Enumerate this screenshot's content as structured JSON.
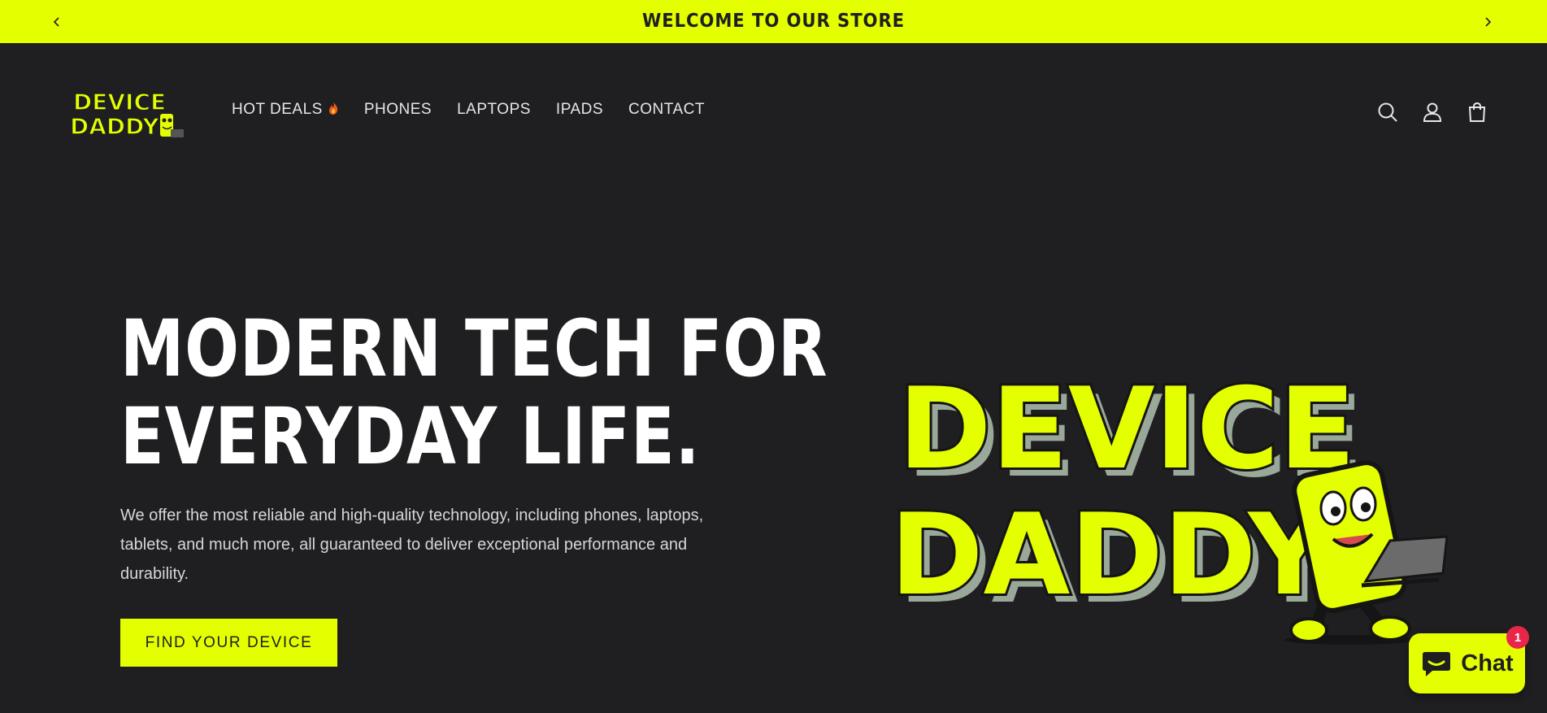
{
  "announcement": {
    "text": "WELCOME TO OUR STORE",
    "prev_icon": "chevron-left-icon",
    "next_icon": "chevron-right-icon"
  },
  "header": {
    "logo_text": [
      "DEVICE",
      "DADDY"
    ],
    "nav": [
      {
        "label": "HOT DEALS",
        "icon": "fire-icon"
      },
      {
        "label": "PHONES"
      },
      {
        "label": "LAPTOPS"
      },
      {
        "label": "IPADS"
      },
      {
        "label": "CONTACT"
      }
    ],
    "icons": [
      "search-icon",
      "account-icon",
      "cart-icon"
    ]
  },
  "hero": {
    "title_line1": "MODERN TECH FOR",
    "title_line2": "EVERYDAY LIFE.",
    "description": "We offer the most reliable and high-quality technology, including phones, laptops, tablets, and much more, all guaranteed to deliver exceptional performance and durability.",
    "cta_label": "FIND YOUR DEVICE",
    "image_text": [
      "DEVICE",
      "DADDY"
    ]
  },
  "chat": {
    "label": "Chat",
    "badge": "1",
    "icon": "chat-bubble-icon"
  },
  "colors": {
    "accent": "#e3ff00",
    "background": "#1f1f21",
    "badge": "#e8264a"
  }
}
